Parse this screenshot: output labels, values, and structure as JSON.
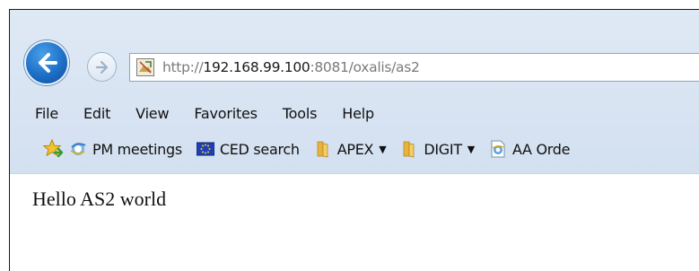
{
  "address_bar": {
    "url_prefix": "http://",
    "url_host": "192.168.99.100",
    "url_suffix": ":8081/oxalis/as2"
  },
  "menu": {
    "items": [
      {
        "label": "File"
      },
      {
        "label": "Edit"
      },
      {
        "label": "View"
      },
      {
        "label": "Favorites"
      },
      {
        "label": "Tools"
      },
      {
        "label": "Help"
      }
    ]
  },
  "favorites_bar": {
    "items": [
      {
        "label": "PM meetings",
        "icon": "ie-page-icon"
      },
      {
        "label": "CED search",
        "icon": "eu-flag-icon"
      },
      {
        "label": "APEX",
        "icon": "folder-icon",
        "dropdown": true
      },
      {
        "label": "DIGIT",
        "icon": "folder-icon",
        "dropdown": true
      },
      {
        "label": "AA Orde",
        "icon": "ie-page-icon"
      }
    ]
  },
  "page": {
    "body_text": "Hello AS2 world"
  },
  "colors": {
    "chrome_bg": "#d9e4f2",
    "back_button": "#1d6fc7",
    "folder": "#e8b33a"
  }
}
